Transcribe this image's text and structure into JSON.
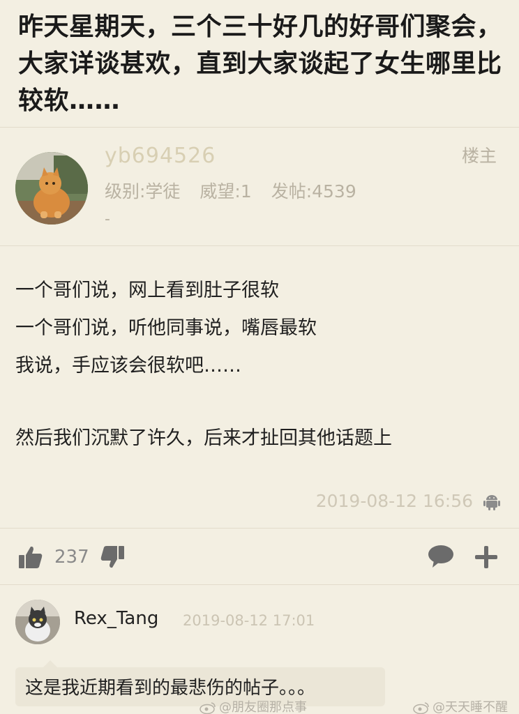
{
  "thread": {
    "title": "昨天星期天，三个三十好几的好哥们聚会，大家详谈甚欢，直到大家谈起了女生哪里比较软……"
  },
  "post": {
    "username": "yb694526",
    "floor": "楼主",
    "level": "级别:学徒",
    "reputation": "威望:1",
    "posts": "发帖:4539",
    "signature": "-",
    "body_lines": [
      "一个哥们说，网上看到肚子很软",
      "一个哥们说，听他同事说，嘴唇最软",
      "我说，手应该会很软吧……",
      "",
      "然后我们沉默了许久，后来才扯回其他话题上"
    ],
    "time": "2019-08-12 16:56",
    "device_icon": "android-icon"
  },
  "actions": {
    "like_count": "237",
    "icons": [
      "thumbs-up-icon",
      "thumbs-down-icon",
      "comment-icon",
      "add-icon"
    ]
  },
  "comment": {
    "username": "Rex_Tang",
    "time": "2019-08-12 17:01",
    "text": "这是我近期看到的最悲伤的帖子。。。"
  },
  "watermarks": {
    "left": "@朋友圈那点事",
    "right": "@天天睡不醒"
  },
  "colors": {
    "background": "#f3efe2",
    "username": "#d8cfb3",
    "meta": "#b9b2a2",
    "bubble": "#ebe6d7"
  }
}
